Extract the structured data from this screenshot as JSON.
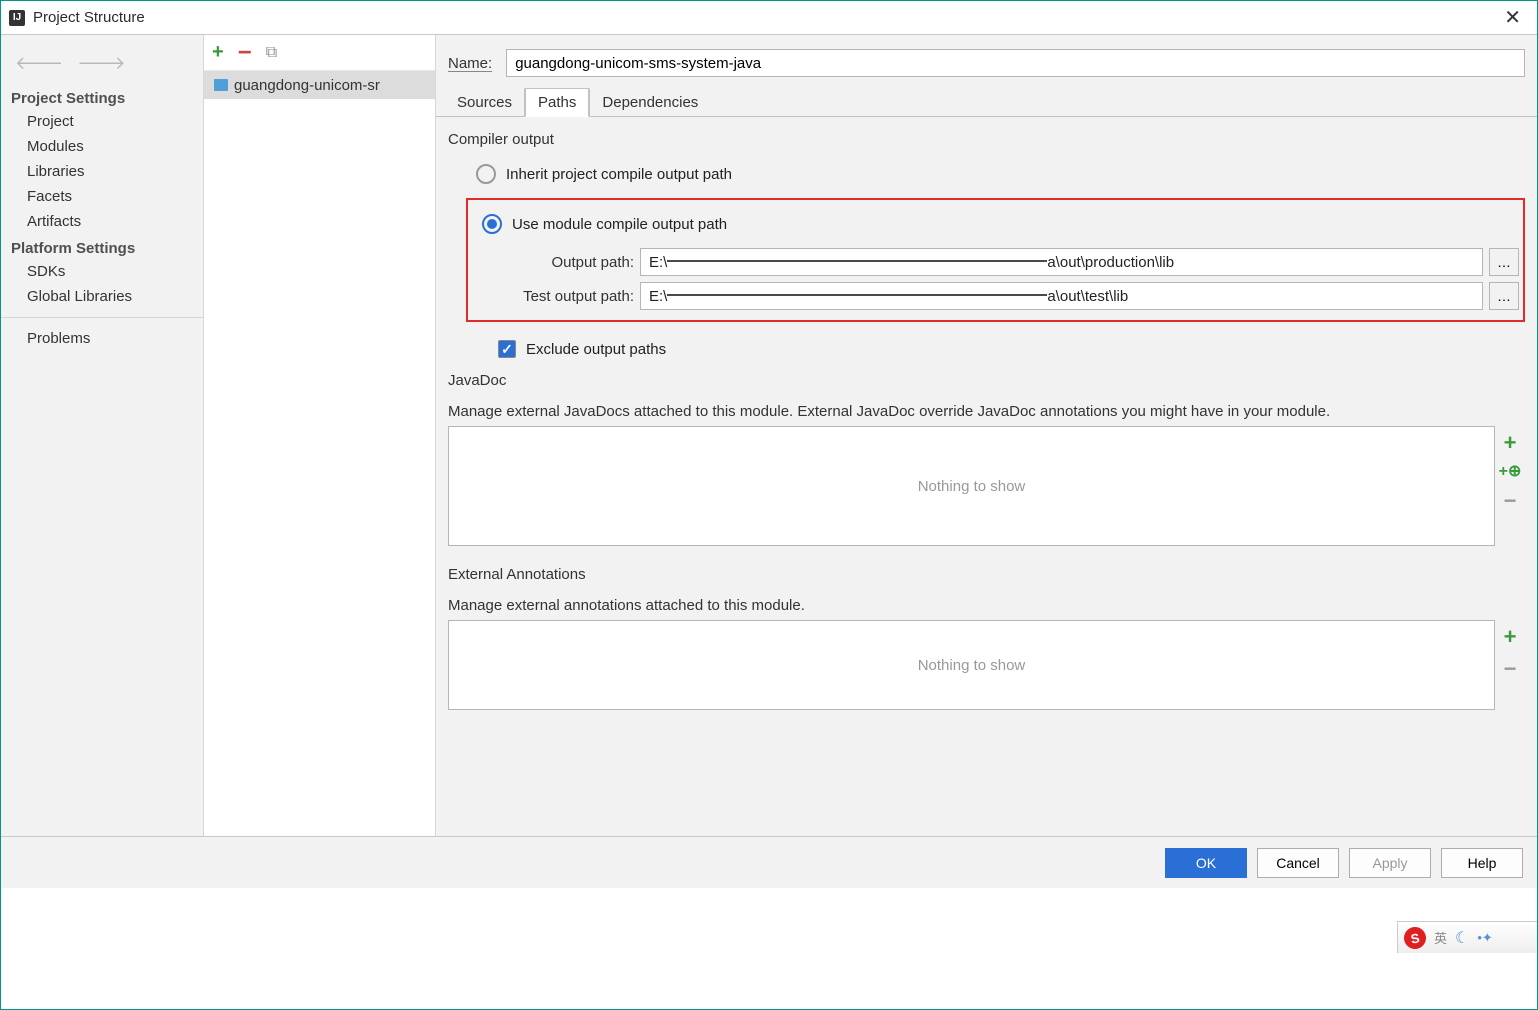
{
  "window": {
    "title": "Project Structure"
  },
  "sidebar": {
    "headers": {
      "project": "Project Settings",
      "platform": "Platform Settings"
    },
    "project_items": [
      "Project",
      "Modules",
      "Libraries",
      "Facets",
      "Artifacts"
    ],
    "platform_items": [
      "SDKs",
      "Global Libraries"
    ],
    "problems": "Problems"
  },
  "module_list": {
    "selected": "guangdong-unicom-sr"
  },
  "name": {
    "label": "Name:",
    "value": "guangdong-unicom-sms-system-java"
  },
  "tabs": [
    "Sources",
    "Paths",
    "Dependencies"
  ],
  "compiler": {
    "section": "Compiler output",
    "radio_inherit": "Inherit project compile output path",
    "radio_module": "Use module compile output path",
    "output_label": "Output path:",
    "output_prefix": "E:\\",
    "output_suffix": "a\\out\\production\\lib",
    "test_label": "Test output path:",
    "test_prefix": "E:\\",
    "test_suffix": "a\\out\\test\\lib",
    "exclude": "Exclude output paths"
  },
  "javadoc": {
    "section": "JavaDoc",
    "desc": "Manage external JavaDocs attached to this module. External JavaDoc override JavaDoc annotations you might have in your module.",
    "empty": "Nothing to show"
  },
  "annotations": {
    "section": "External Annotations",
    "desc": "Manage external annotations attached to this module.",
    "empty": "Nothing to show"
  },
  "footer": {
    "ok": "OK",
    "cancel": "Cancel",
    "apply": "Apply",
    "help": "Help"
  },
  "ime": {
    "lang": "英"
  }
}
